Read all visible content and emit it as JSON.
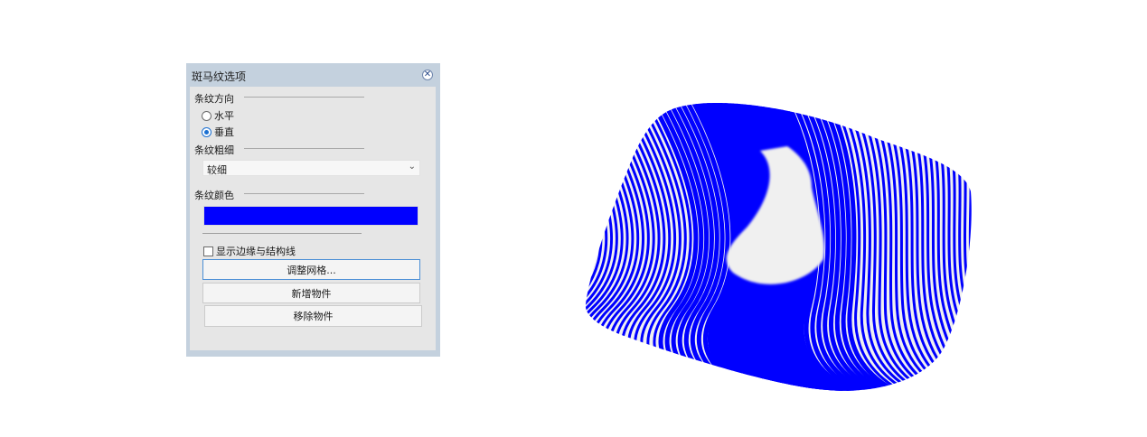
{
  "dialog": {
    "title": "斑马纹选项",
    "close_icon": "close-icon",
    "stripe_direction": {
      "label": "条纹方向",
      "options": [
        {
          "label": "水平",
          "checked": false
        },
        {
          "label": "垂直",
          "checked": true
        }
      ]
    },
    "stripe_thickness": {
      "label": "条纹粗细",
      "selected": "较细"
    },
    "stripe_color": {
      "label": "条纹颜色",
      "value": "#0000ff"
    },
    "show_edges": {
      "label": "显示边缘与结构线",
      "checked": false
    },
    "buttons": {
      "adjust_mesh": "调整网格...",
      "add_object": "新增物件",
      "remove_object": "移除物件"
    }
  },
  "viewport": {
    "stripe_color": "#0000ff",
    "background_color": "#f0f0f0"
  }
}
